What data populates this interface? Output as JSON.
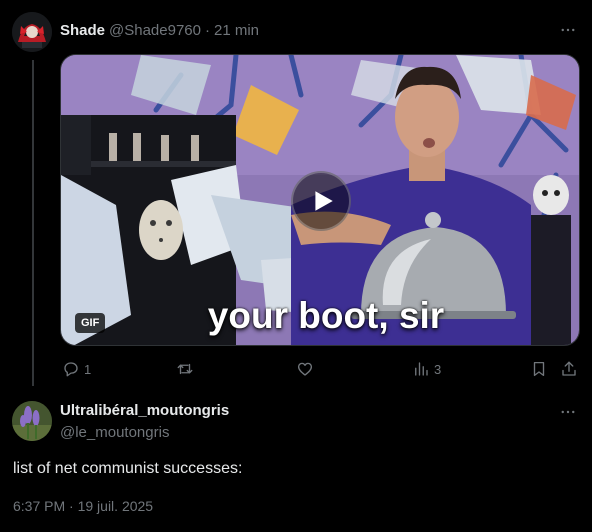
{
  "tweet1": {
    "author_name": "Shade",
    "handle": "@Shade9760",
    "separator": "·",
    "time": "21 min",
    "media": {
      "badge": "GIF",
      "caption": "your boot, sir"
    },
    "actions": {
      "replies": "1",
      "retweets": "",
      "likes": "",
      "views": "3"
    }
  },
  "tweet2": {
    "author_name": "Ultralibéral_moutongris",
    "handle": "@le_moutongris",
    "text": "list of net communist successes:",
    "timestamp": "6:37 PM · 19 juil. 2025"
  },
  "colors": {
    "background": "#000000",
    "text_primary": "#e7e9ea",
    "text_secondary": "#71767b",
    "border": "#2f3336"
  }
}
